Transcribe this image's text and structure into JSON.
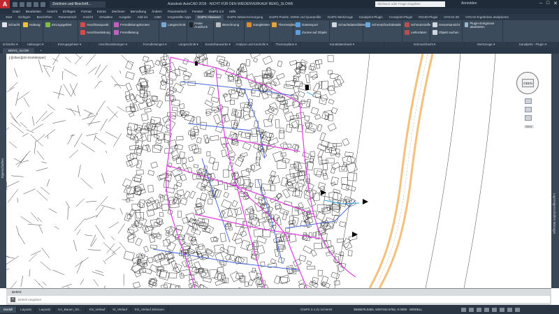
{
  "title_bar": {
    "workspace": "Zeichnen und Beschrift...",
    "app_title": "Autodesk AutoCAD 2018 - NICHT FÜR DEN WIEDERVERKAUF   BERG_SLOW6",
    "search_placeholder": "Stichwort oder Frage eingeben",
    "sign_in": "Anmelden"
  },
  "menu": [
    "Datei",
    "Bearbeiten",
    "Ansicht",
    "Einfügen",
    "Format",
    "Extras",
    "Zeichnen",
    "Bemaßung",
    "Ändern",
    "Parametrisch",
    "Fenster",
    "GraPS 2.0",
    "Hilfe"
  ],
  "ribbon_tabs": [
    "Start",
    "Einfügen",
    "Beschriften",
    "Parametrisch",
    "Ansicht",
    "Verwalten",
    "Ausgabe",
    "Add-ins",
    "A360",
    "Vorgestellte Apps",
    "GraPS Abwasser",
    "GraPS Wasserversorgung",
    "GraPS Punkte, DOMs und Querprofile",
    "GraPS Werkzeuge",
    "Kanalprint-Plugin",
    "Crossprint-Plugin",
    "RS100-Plugin",
    "HYKAS-2D",
    "HYKAS Ergebnisse analysieren"
  ],
  "active_tab_index": 10,
  "ribbon_groups": [
    {
      "items": [
        "Schacht"
      ],
      "color": "#e1e4e8"
    },
    {
      "items": [
        "Haltung"
      ],
      "color": "#f1c232"
    },
    {
      "items": [
        "Einzugsgebiet"
      ],
      "color": "#7fbf3f"
    },
    {
      "items": [
        "Anschlusspunkt",
        "Anschlussleitung"
      ],
      "color": "#d84a4a"
    },
    {
      "items": [
        "Fremdleitungsknoten",
        "Fremdleitung"
      ],
      "color": "#c060c0"
    },
    {
      "items": [
        "Längsschnitt"
      ],
      "color": "#7aa7d8"
    },
    {
      "items": [
        "Freier Ausdruck"
      ],
      "color": "#222222"
    },
    {
      "items": [
        "Berechnung"
      ],
      "color": "#bcbcbc"
    },
    {
      "items": [
        "Gangleisten"
      ],
      "color": "#e08a2e"
    },
    {
      "items": [
        "Themenpläne"
      ],
      "color": "#e4a23a"
    },
    {
      "items": [
        "Dateiexport",
        "Zoome auf Objekt"
      ],
      "color": "#5aa0e0"
    },
    {
      "items": [
        "Schachtdatenblätter"
      ],
      "color": "#d0d6dc"
    },
    {
      "items": [
        "Schmutzfrachtdetails"
      ],
      "color": "#6aa9de"
    },
    {
      "items": [
        "Schmutzstoffe",
        "Lieferdaten"
      ],
      "color": "#b75050"
    },
    {
      "items": [
        "Gesamtansicht",
        "Objekt suchen"
      ],
      "color": "#cfd6dd"
    },
    {
      "items": [
        "Plugin-Ereignisse abarbeiten"
      ],
      "color": "#9fb7cc"
    }
  ],
  "panel_labels": [
    "Schächte",
    "Haltungen",
    "Einzugsgebiete",
    "Anschlussleitungen",
    "Fremdleitungen",
    "Längsschnitt",
    "Sonderbauwerke",
    "Analyse und Kontrolle",
    "Themenpläne",
    "Kanaldatenbank",
    "Schmutzfracht",
    "Werkzeuge",
    "Kanalprint - Plugin"
  ],
  "doc_tabs": {
    "active": "BERG_SLOW",
    "add": "+"
  },
  "viewport_label": "[-][Oben][2D-Drahtkörper]",
  "left_palette": "Eigenschaften",
  "right_palette": "Layereigenschaften-Manager",
  "navcube": {
    "face": "OBEN",
    "wcs": "WKS"
  },
  "command": {
    "history": "Befehl:",
    "placeholder": "Befehl eingeben"
  },
  "layout_tabs": [
    "Modell",
    "Layout1",
    "Layout2",
    "KA_Bauen_Str...",
    "KN_Verlauf",
    "Kl_Verlauf",
    "KG_Verlauf Zeitraum"
  ],
  "status": {
    "message": "GraPS 3.4.31 ist bereit",
    "coords": "3545676.0494, 5297342.6762, 0.0000",
    "mode": "MODELL"
  },
  "colors": {
    "sewer_main": "#e03ce0",
    "sewer_blue": "#3a5ed8",
    "water_cyan": "#2aa0d8",
    "road": "#f4c07a",
    "title_bar": "#1f2b38",
    "ribbon": "#3c4b5b"
  }
}
